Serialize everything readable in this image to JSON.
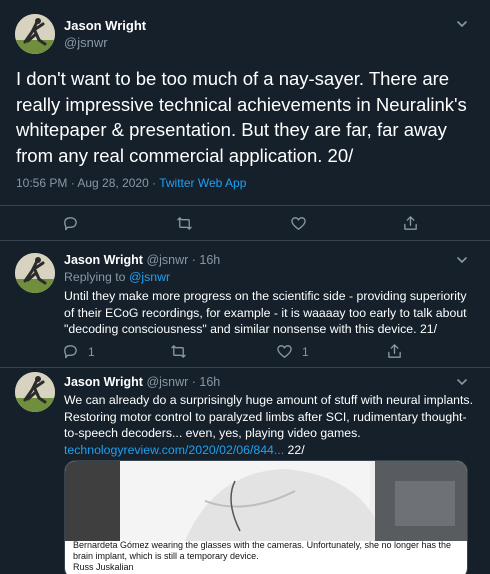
{
  "main_tweet": {
    "author_name": "Jason Wright",
    "author_handle": "@jsnwr",
    "text": "I don't want to be too much of a nay-sayer. There are really impressive technical achievements in Neuralink's whitepaper & presentation. But they are far, far away from any real commercial application. 20/",
    "timestamp": "10:56 PM · Aug 28, 2020 · ",
    "source": "Twitter Web App",
    "actions": [
      "reply-icon",
      "retweet-icon",
      "like-icon",
      "share-icon"
    ]
  },
  "replies": [
    {
      "author_name": "Jason Wright",
      "author_handle": "@jsnwr",
      "separator": " · ",
      "age": "16h",
      "replying_label": "Replying to ",
      "replying_to": "@jsnwr",
      "text": "Until they make more progress on the scientific side - providing superiority of their ECoG recordings, for example - it is waaaay too early to talk about \"decoding consciousness\" and similar nonsense with this device. 21/",
      "reply_count": "1",
      "retweet_count": "",
      "like_count": "1"
    },
    {
      "author_name": "Jason Wright",
      "author_handle": "@jsnwr",
      "separator": " · ",
      "age": "16h",
      "text": "We can already do a surprisingly huge amount of stuff with neural implants. Restoring motor control to paralyzed limbs after SCI, rudimentary thought-to-speech decoders... even, yes, playing video games. ",
      "link": "technologyreview.com/2020/02/06/844...",
      "text_suffix": " 22/",
      "card_caption": "Bernardeta Gómez wearing the glasses with the cameras. Unfortunately, she no longer has the brain implant, which is still a temporary device.",
      "card_credit": "Russ Juskalian"
    }
  ],
  "colors": {
    "background": "#15202b",
    "text": "#ffffff",
    "muted": "#8899a6",
    "accent": "#1da1f2",
    "border": "#38444d"
  }
}
